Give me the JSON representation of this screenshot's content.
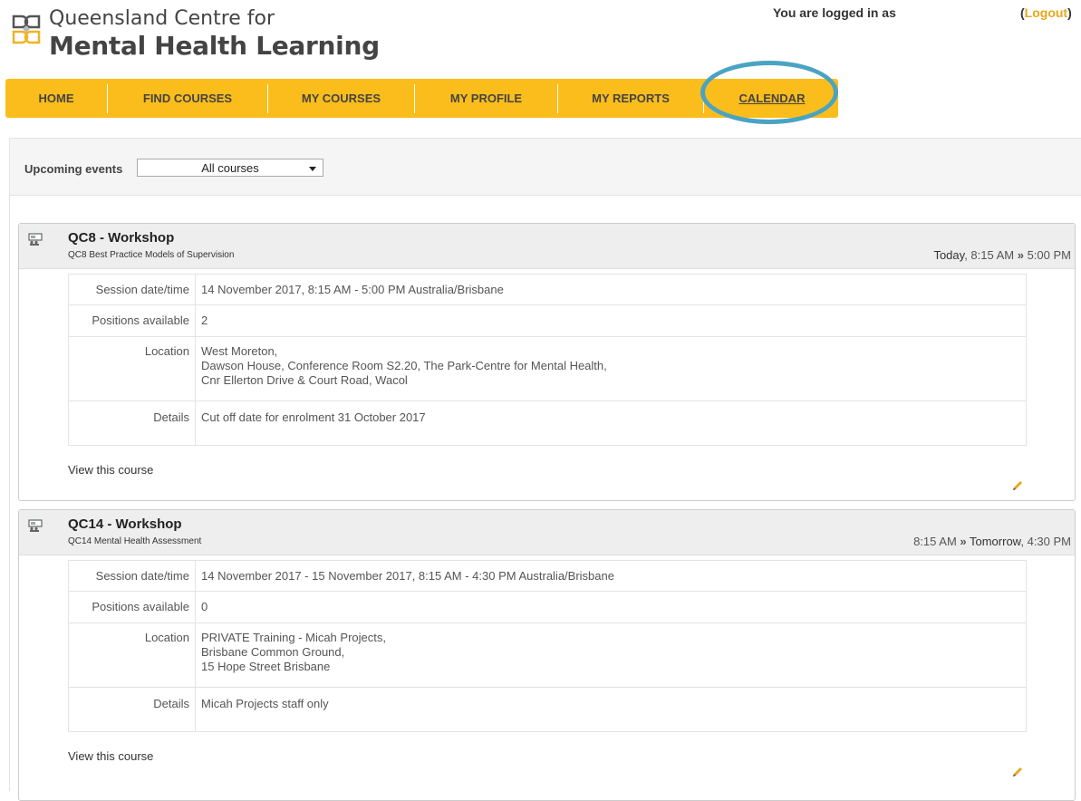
{
  "logo": {
    "line1": "Queensland Centre for",
    "line2": "Mental Health Learning"
  },
  "header": {
    "login_text": "You are logged in as",
    "logout_open": "(",
    "logout_label": "Logout",
    "logout_close": ")"
  },
  "nav": {
    "items": [
      {
        "label": "HOME"
      },
      {
        "label": "FIND COURSES"
      },
      {
        "label": "MY COURSES"
      },
      {
        "label": "MY PROFILE"
      },
      {
        "label": "MY REPORTS"
      },
      {
        "label": "CALENDAR"
      }
    ],
    "active_index": 5,
    "color_bar": "#fbbd1c",
    "color_highlight_ring": "#4aa3c2"
  },
  "filter": {
    "label": "Upcoming events",
    "selected": "All courses"
  },
  "events": [
    {
      "title": "QC8 - Workshop",
      "subtitle": "QC8 Best Practice Models of Supervision",
      "time_start": "Today",
      "time_start_rest": ", 8:15 AM ",
      "time_sep": "»",
      "time_end": " 5:00 PM",
      "rows": {
        "session_label": "Session date/time",
        "session_value": "14 November 2017, 8:15 AM - 5:00 PM Australia/Brisbane",
        "positions_label": "Positions available",
        "positions_value": "2",
        "location_label": "Location",
        "location_lines": [
          "West Moreton,",
          "Dawson House, Conference Room S2.20, The Park-Centre for Mental Health,",
          "Cnr Ellerton Drive & Court Road, Wacol"
        ],
        "details_label": "Details",
        "details_value": "Cut off date for enrolment 31 October 2017"
      },
      "view_link": "View this course"
    },
    {
      "title": "QC14 - Workshop",
      "subtitle": "QC14 Mental Health Assessment",
      "time_start": "8:15 AM ",
      "time_sep": "»",
      "time_end_day": " Tomorrow",
      "time_end": ", 4:30 PM",
      "rows": {
        "session_label": "Session date/time",
        "session_value": "14 November 2017 - 15 November 2017, 8:15 AM - 4:30 PM Australia/Brisbane",
        "positions_label": "Positions available",
        "positions_value": "0",
        "location_label": "Location",
        "location_lines": [
          "PRIVATE Training - Micah Projects,",
          "Brisbane Common Ground,",
          "15 Hope Street Brisbane"
        ],
        "details_label": "Details",
        "details_value": "Micah Projects staff only"
      },
      "view_link": "View this course"
    }
  ]
}
